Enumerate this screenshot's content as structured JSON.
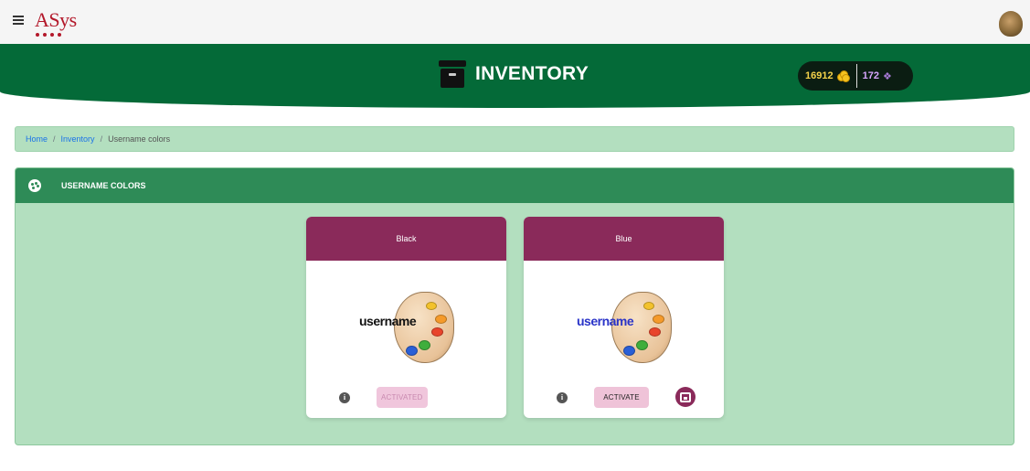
{
  "app": {
    "logo_text": "ASys",
    "avatar_icon": "user-avatar-icon"
  },
  "header": {
    "title": "INVENTORY",
    "coins": "16912",
    "coins_icon": "coins-icon",
    "gems": "172",
    "gems_icon": "gems-icon",
    "color": "#046a38"
  },
  "breadcrumb": {
    "items": [
      {
        "label": "Home"
      },
      {
        "label": "Inventory"
      }
    ],
    "current": "Username colors"
  },
  "section": {
    "title": "USERNAME COLORS",
    "icon": "palette-icon"
  },
  "cards": [
    {
      "title": "Black",
      "preview_text": "username",
      "preview_color": "#111111",
      "info_icon": "info-icon",
      "button_label": "ACTIVATED",
      "button_enabled": false
    },
    {
      "title": "Blue",
      "preview_text": "username",
      "preview_color": "#2a34c8",
      "info_icon": "info-icon",
      "button_label": "ACTIVATE",
      "button_enabled": true,
      "extra_icon": "unbox-icon"
    }
  ]
}
